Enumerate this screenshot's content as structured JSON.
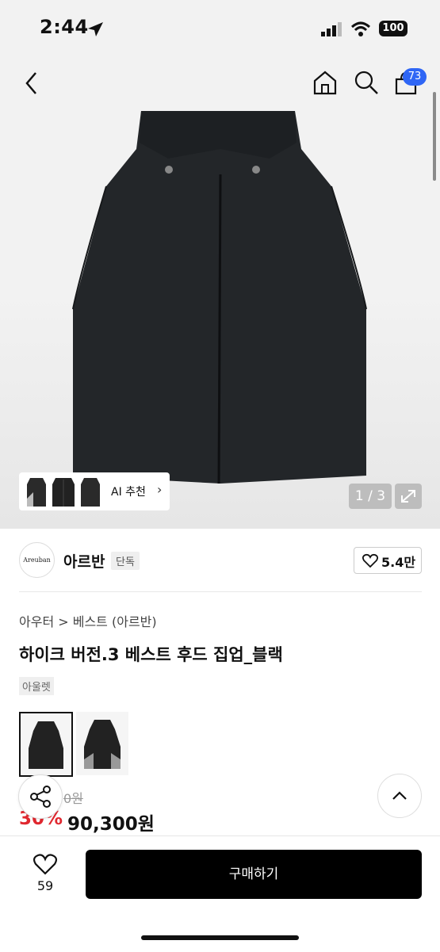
{
  "status": {
    "time": "2:44",
    "battery": "100"
  },
  "header": {
    "cart_count": "73"
  },
  "gallery": {
    "ai_label": "AI 추천",
    "pager": "1 / 3"
  },
  "brand": {
    "logo_text": "Areuban",
    "name": "아르반",
    "tag": "단독",
    "likes": "5.4만"
  },
  "product": {
    "breadcrumb": "아우터  >  베스트 (아르반)",
    "title": "하이크 버전.3 베스트 후드 집업_블랙",
    "tag": "아울렛",
    "original_price_partial": "0원",
    "discount": "30%",
    "price": "90,300원"
  },
  "bottom": {
    "heart_count": "59",
    "buy_label": "구매하기"
  }
}
